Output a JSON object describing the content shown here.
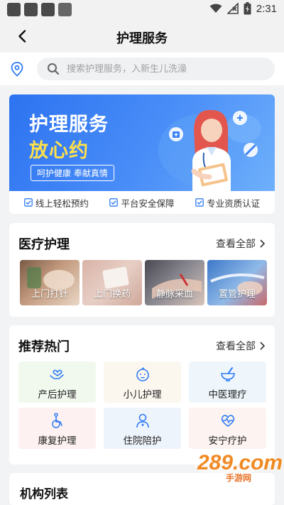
{
  "status_bar": {
    "time": "2:31"
  },
  "header": {
    "title": "护理服务"
  },
  "search": {
    "placeholder": "搜索护理服务，入新生儿洗澡"
  },
  "banner": {
    "title_line1": "护理服务",
    "title_line2": "放心约",
    "tag": "呵护健康 奉献真情",
    "colors": {
      "start": "#2d73f0",
      "end": "#6fb0fb",
      "highlight": "#ffe14a"
    }
  },
  "features": [
    {
      "label": "线上轻松预约",
      "icon": "check-square-icon"
    },
    {
      "label": "平台安全保障",
      "icon": "check-square-icon"
    },
    {
      "label": "专业资质认证",
      "icon": "check-square-icon"
    }
  ],
  "medical": {
    "title": "医疗护理",
    "view_all": "查看全部",
    "items": [
      {
        "label": "上门打针"
      },
      {
        "label": "上门换药"
      },
      {
        "label": "静脉采血"
      },
      {
        "label": "置管护理"
      }
    ]
  },
  "hot": {
    "title": "推荐热门",
    "view_all": "查看全部",
    "items": [
      {
        "label": "产后护理",
        "icon": "heart-hands-icon",
        "bg": "#f1f8ee"
      },
      {
        "label": "小儿护理",
        "icon": "baby-face-icon",
        "bg": "#fbf7ef"
      },
      {
        "label": "中医理疗",
        "icon": "mortar-bowl-icon",
        "bg": "#eef6fb"
      },
      {
        "label": "康复护理",
        "icon": "wheelchair-icon",
        "bg": "#fdf1f1"
      },
      {
        "label": "住院陪护",
        "icon": "nurse-icon",
        "bg": "#eef4fb"
      },
      {
        "label": "安宁疗护",
        "icon": "heart-pulse-icon",
        "bg": "#fdf3f1"
      }
    ]
  },
  "org": {
    "title": "机构列表"
  },
  "watermark": {
    "text": "289.com",
    "sub": "手游网"
  },
  "accent_color": "#2f7bf5"
}
